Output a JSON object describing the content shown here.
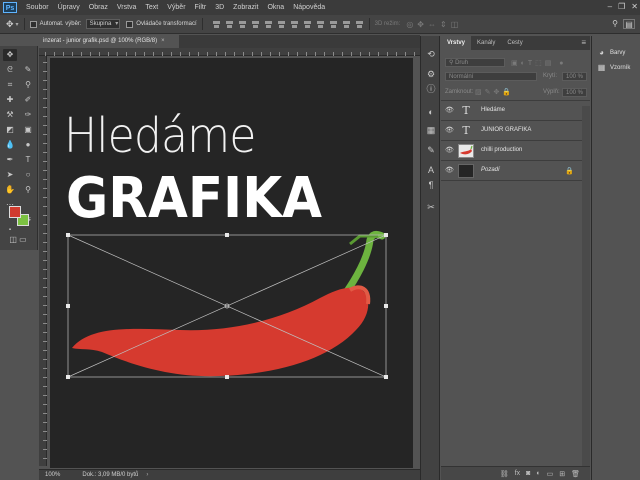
{
  "menubar": {
    "logo": "Ps",
    "items": [
      "Soubor",
      "Úpravy",
      "Obraz",
      "Vrstva",
      "Text",
      "Výběr",
      "Filtr",
      "3D",
      "Zobrazit",
      "Okna",
      "Nápověda"
    ]
  },
  "options_bar": {
    "auto_select_label": "Automat. výběr:",
    "auto_select_value": "Skupina",
    "transform_label": "Ovládače transformací",
    "mode_3d": "3D režim:"
  },
  "document": {
    "tab_title": "inzerat - junior grafik.psd @ 100% (RGB/8)",
    "close": "×",
    "headline_line1": "Hledáme",
    "headline_line2": "GRAFIKA"
  },
  "statusbar": {
    "zoom": "100%",
    "doc_info": "Dok.: 3,09 MB/0 bytů"
  },
  "layers_panel": {
    "tabs": [
      "Vrstvy",
      "Kanály",
      "Cesty"
    ],
    "active_tab": "Vrstvy",
    "filter_placeholder": "Druh",
    "blend_mode": "Normální",
    "opacity_label": "Krytí:",
    "opacity_value": "100 %",
    "lock_label": "Zamknout:",
    "fill_label": "Výplň:",
    "fill_value": "100 %",
    "layers": [
      {
        "name": "Hledáme",
        "type": "text",
        "thumb": "T"
      },
      {
        "name": "JUNIOR GRAFIKA",
        "type": "text",
        "thumb": "T"
      },
      {
        "name": "chilli production",
        "type": "image",
        "thumb": ""
      },
      {
        "name": "Pozadí",
        "type": "background",
        "thumb": "",
        "locked": true
      }
    ]
  },
  "right_dock": {
    "items": [
      "Barvy",
      "Vzorník"
    ]
  },
  "colors": {
    "foreground": "#d03b2e",
    "background": "#7cc242",
    "canvas_bg": "#252525",
    "chilli_red": "#d63a2f",
    "chilli_stem": "#6db33f"
  }
}
